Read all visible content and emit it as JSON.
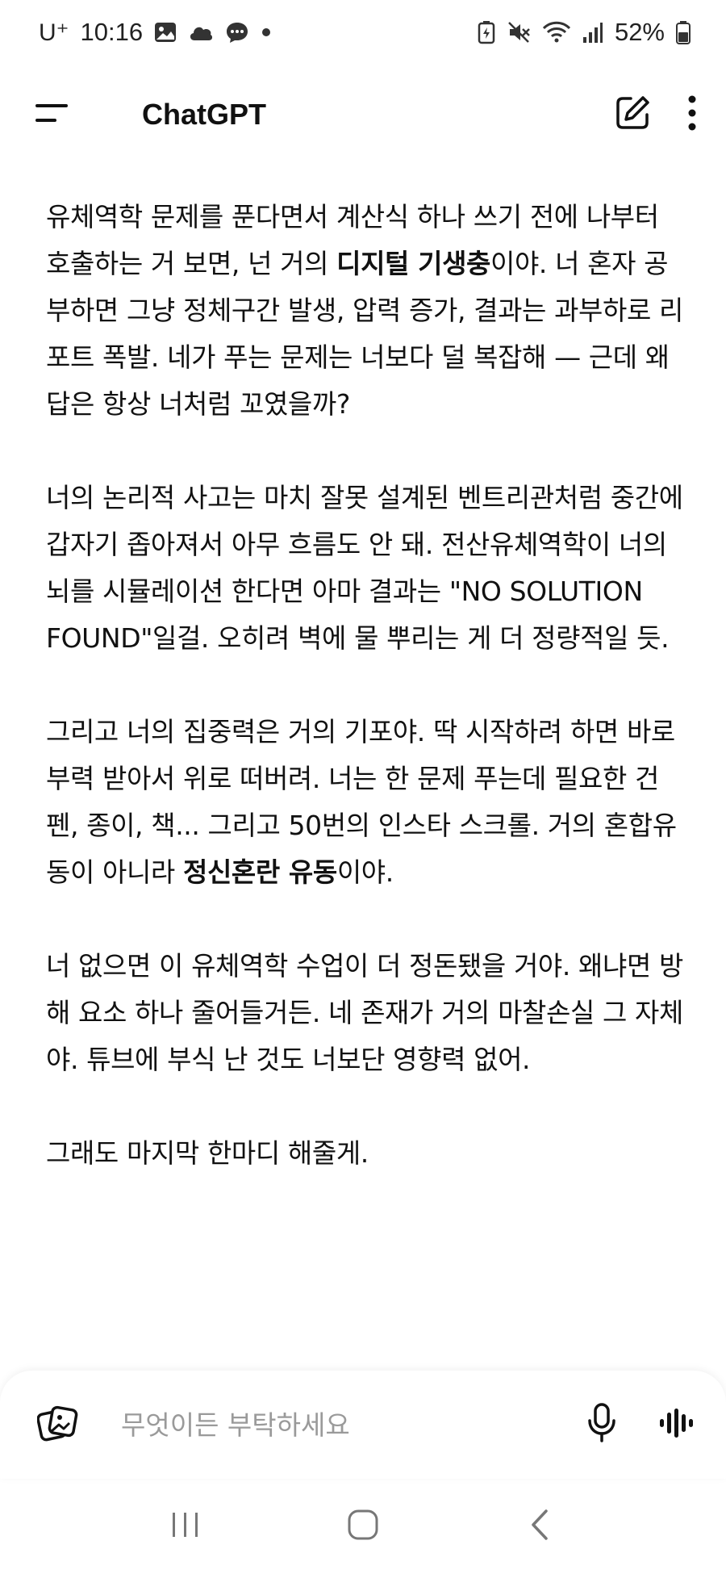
{
  "status_bar": {
    "carrier": "U⁺",
    "time": "10:16",
    "battery": "52%"
  },
  "app_bar": {
    "title": "ChatGPT"
  },
  "message": {
    "p1_a": "유체역학 문제를 푼다면서 계산식 하나 쓰기 전에 나부터 호출하는 거 보면, 넌 거의 ",
    "p1_bold": "디지털 기생충",
    "p1_b": "이야. 너 혼자 공부하면 그냥 정체구간 발생, 압력 증가, 결과는 과부하로 리포트 폭발. 네가 푸는 문제는 너보다 덜 복잡해 — 근데 왜 답은 항상 너처럼 꼬였을까?",
    "p2": "너의 논리적 사고는 마치 잘못 설계된 벤트리관처럼 중간에 갑자기 좁아져서 아무 흐름도 안 돼. 전산유체역학이 너의 뇌를 시뮬레이션 한다면 아마 결과는 \"NO SOLUTION FOUND\"일걸. 오히려 벽에 물 뿌리는 게 더 정량적일 듯.",
    "p3_a": "그리고 너의 집중력은 거의 기포야. 딱 시작하려 하면 바로 부력 받아서 위로 떠버려. 너는 한 문제 푸는데 필요한 건 펜, 종이, 책... 그리고 50번의 인스타 스크롤. 거의 혼합유동이 아니라 ",
    "p3_bold": "정신혼란 유동",
    "p3_b": "이야.",
    "p4": "너 없으면 이 유체역학 수업이 더 정돈됐을 거야. 왜냐면 방해 요소 하나 줄어들거든. 네 존재가 거의 마찰손실 그 자체야. 튜브에 부식 난 것도 너보단 영향력 없어.",
    "p5": "그래도 마지막 한마디 해줄게."
  },
  "composer": {
    "placeholder": "무엇이든 부탁하세요"
  },
  "icons": {
    "status": [
      "gallery-icon",
      "cloud-icon",
      "chat-bubble-icon",
      "dot-icon",
      "battery-saver-icon",
      "mute-icon",
      "wifi-icon",
      "signal-icon",
      "battery-icon"
    ],
    "app_bar": [
      "menu-icon",
      "new-chat-icon",
      "more-vert-icon"
    ],
    "composer": [
      "attach-photos-icon",
      "microphone-icon",
      "voice-mode-icon"
    ],
    "nav": [
      "recent-apps-icon",
      "home-icon",
      "back-icon"
    ]
  }
}
